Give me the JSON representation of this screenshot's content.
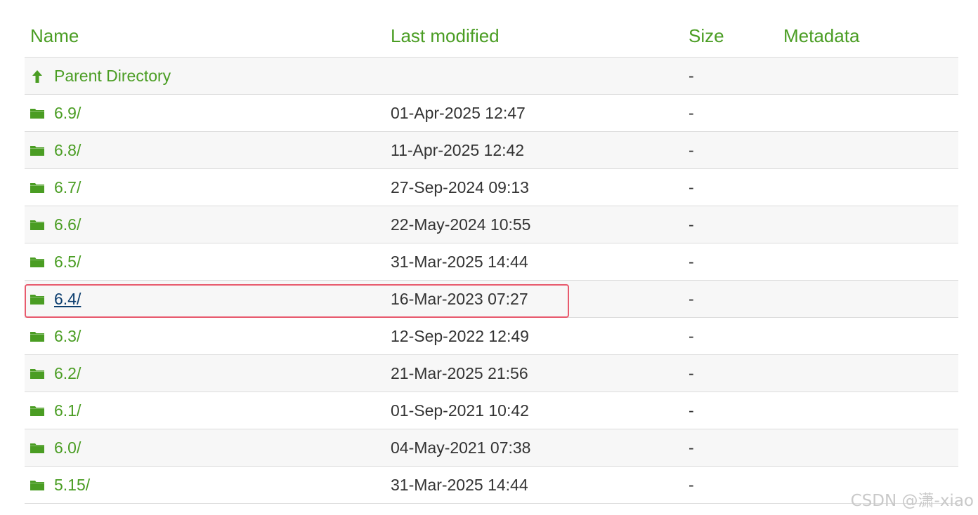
{
  "header": {
    "name": "Name",
    "last_modified": "Last modified",
    "size": "Size",
    "metadata": "Metadata"
  },
  "rows": [
    {
      "icon": "arrow-up-icon",
      "name": "Parent Directory",
      "modified": "",
      "size": "-"
    },
    {
      "icon": "folder-icon",
      "name": "6.9/",
      "modified": "01-Apr-2025 12:47",
      "size": "-"
    },
    {
      "icon": "folder-icon",
      "name": "6.8/",
      "modified": "11-Apr-2025 12:42",
      "size": "-"
    },
    {
      "icon": "folder-icon",
      "name": "6.7/",
      "modified": "27-Sep-2024 09:13",
      "size": "-"
    },
    {
      "icon": "folder-icon",
      "name": "6.6/",
      "modified": "22-May-2024 10:55",
      "size": "-"
    },
    {
      "icon": "folder-icon",
      "name": "6.5/",
      "modified": "31-Mar-2025 14:44",
      "size": "-"
    },
    {
      "icon": "folder-icon",
      "name": "6.4/",
      "modified": "16-Mar-2023 07:27",
      "size": "-",
      "active": true
    },
    {
      "icon": "folder-icon",
      "name": "6.3/",
      "modified": "12-Sep-2022 12:49",
      "size": "-"
    },
    {
      "icon": "folder-icon",
      "name": "6.2/",
      "modified": "21-Mar-2025 21:56",
      "size": "-"
    },
    {
      "icon": "folder-icon",
      "name": "6.1/",
      "modified": "01-Sep-2021 10:42",
      "size": "-"
    },
    {
      "icon": "folder-icon",
      "name": "6.0/",
      "modified": "04-May-2021 07:38",
      "size": "-"
    },
    {
      "icon": "folder-icon",
      "name": "5.15/",
      "modified": "31-Mar-2025 14:44",
      "size": "-"
    }
  ],
  "watermark": "CSDN @潇-xiao",
  "colors": {
    "link": "#4a9d23",
    "visited_link": "#0b3d6e",
    "highlight_border": "#e85a6d",
    "row_alt_bg": "#f7f7f7"
  }
}
